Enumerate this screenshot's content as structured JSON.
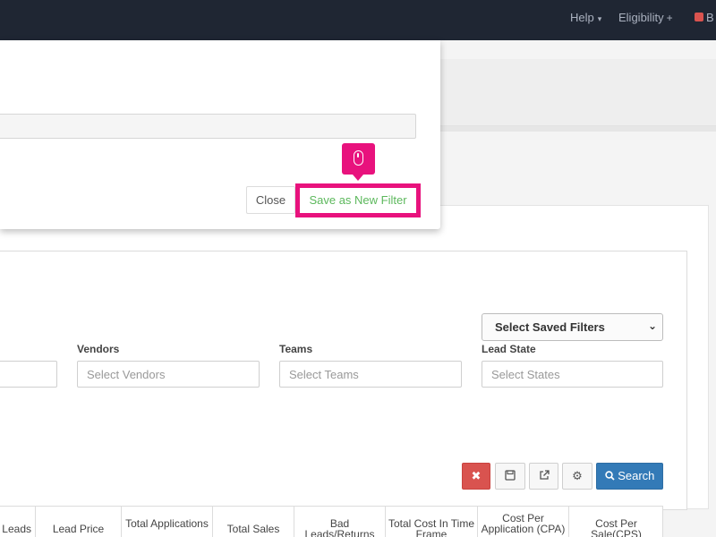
{
  "nav": {
    "help": "Help",
    "eligibility": "Eligibility",
    "truncated_item": "B"
  },
  "filters": {
    "saved_filters_select": "Select Saved Filters",
    "vendors_label": "Vendors",
    "vendors_placeholder": "Select Vendors",
    "teams_label": "Teams",
    "teams_placeholder": "Select Teams",
    "lead_state_label": "Lead State",
    "lead_state_placeholder": "Select States"
  },
  "actions": {
    "clear_icon": "x-icon",
    "save_icon": "save-icon",
    "export_icon": "external-link-icon",
    "settings_icon": "gear-icon",
    "search_label": "Search"
  },
  "table": {
    "columns": [
      "Leads",
      "Lead Price",
      "Total Applications",
      "Total Sales",
      "Bad Leads/Returns",
      "Total Cost In Time Frame",
      "Cost Per Application (CPA)",
      "Cost Per Sale(CPS)"
    ]
  },
  "modal": {
    "close_label": "Close",
    "save_new_label": "Save as New Filter"
  },
  "colors": {
    "navbar": "#1f2633",
    "highlight": "#e8127d",
    "success_text": "#5cb85c",
    "danger": "#d9534f",
    "primary": "#337ab7"
  }
}
